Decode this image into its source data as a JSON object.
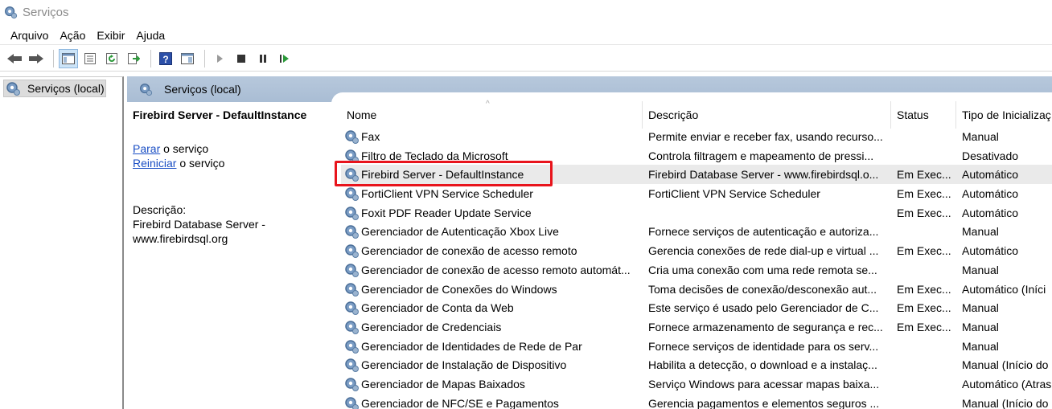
{
  "window": {
    "title": "Serviços"
  },
  "menu": [
    "Arquivo",
    "Ação",
    "Exibir",
    "Ajuda"
  ],
  "toolbar": {
    "buttons": [
      "back-icon",
      "forward-icon",
      "console-tree-icon",
      "properties-icon",
      "refresh-icon",
      "export-list-icon",
      "help-icon",
      "view-icon",
      "start-icon",
      "stop-icon",
      "pause-icon",
      "restart-icon"
    ]
  },
  "tree": {
    "root_label": "Serviços (local)"
  },
  "panel": {
    "header_label": "Serviços (local)"
  },
  "details": {
    "service_title": "Firebird Server - DefaultInstance",
    "stop_link": "Parar",
    "stop_suffix": " o serviço",
    "restart_link": "Reiniciar",
    "restart_suffix": " o serviço",
    "desc_label": "Descrição:",
    "desc_line1": "Firebird Database Server -",
    "desc_line2": "www.firebirdsql.org"
  },
  "columns": {
    "name": "Nome",
    "desc": "Descrição",
    "status": "Status",
    "type": "Tipo de Inicializaç"
  },
  "services": [
    {
      "name": "Fax",
      "desc": "Permite enviar e receber fax, usando recurso...",
      "status": "",
      "type": "Manual"
    },
    {
      "name": "Filtro de Teclado da Microsoft",
      "desc": "Controla filtragem e mapeamento de pressi...",
      "status": "",
      "type": "Desativado"
    },
    {
      "name": "Firebird Server - DefaultInstance",
      "desc": "Firebird Database Server - www.firebirdsql.o...",
      "status": "Em Exec...",
      "type": "Automático"
    },
    {
      "name": "FortiClient VPN Service Scheduler",
      "desc": "FortiClient VPN Service Scheduler",
      "status": "Em Exec...",
      "type": "Automático"
    },
    {
      "name": "Foxit PDF Reader Update Service",
      "desc": "",
      "status": "Em Exec...",
      "type": "Automático"
    },
    {
      "name": "Gerenciador de Autenticação Xbox Live",
      "desc": "Fornece serviços de autenticação e autoriza...",
      "status": "",
      "type": "Manual"
    },
    {
      "name": "Gerenciador de conexão de acesso remoto",
      "desc": "Gerencia conexões de rede dial-up e virtual ...",
      "status": "Em Exec...",
      "type": "Automático"
    },
    {
      "name": "Gerenciador de conexão de acesso remoto automát...",
      "desc": "Cria uma conexão com uma rede remota se...",
      "status": "",
      "type": "Manual"
    },
    {
      "name": "Gerenciador de Conexões do Windows",
      "desc": "Toma decisões de conexão/desconexão aut...",
      "status": "Em Exec...",
      "type": "Automático (Iníci"
    },
    {
      "name": "Gerenciador de Conta da Web",
      "desc": "Este serviço é usado pelo Gerenciador de C...",
      "status": "Em Exec...",
      "type": "Manual"
    },
    {
      "name": "Gerenciador de Credenciais",
      "desc": "Fornece armazenamento de segurança e rec...",
      "status": "Em Exec...",
      "type": "Manual"
    },
    {
      "name": "Gerenciador de Identidades de Rede de Par",
      "desc": "Fornece serviços de identidade para os serv...",
      "status": "",
      "type": "Manual"
    },
    {
      "name": "Gerenciador de Instalação de Dispositivo",
      "desc": "Habilita a detecção, o download e a instalaç...",
      "status": "",
      "type": "Manual (Início do"
    },
    {
      "name": "Gerenciador de Mapas Baixados",
      "desc": "Serviço Windows para acessar mapas baixa...",
      "status": "",
      "type": "Automático (Atras"
    },
    {
      "name": "Gerenciador de NFC/SE e Pagamentos",
      "desc": "Gerencia pagamentos e elementos seguros ...",
      "status": "",
      "type": "Manual (Início do"
    }
  ],
  "selected_index": 2,
  "colors": {
    "header": "#b2c4da",
    "highlight": "#e8141c",
    "link": "#1a4ec4"
  }
}
